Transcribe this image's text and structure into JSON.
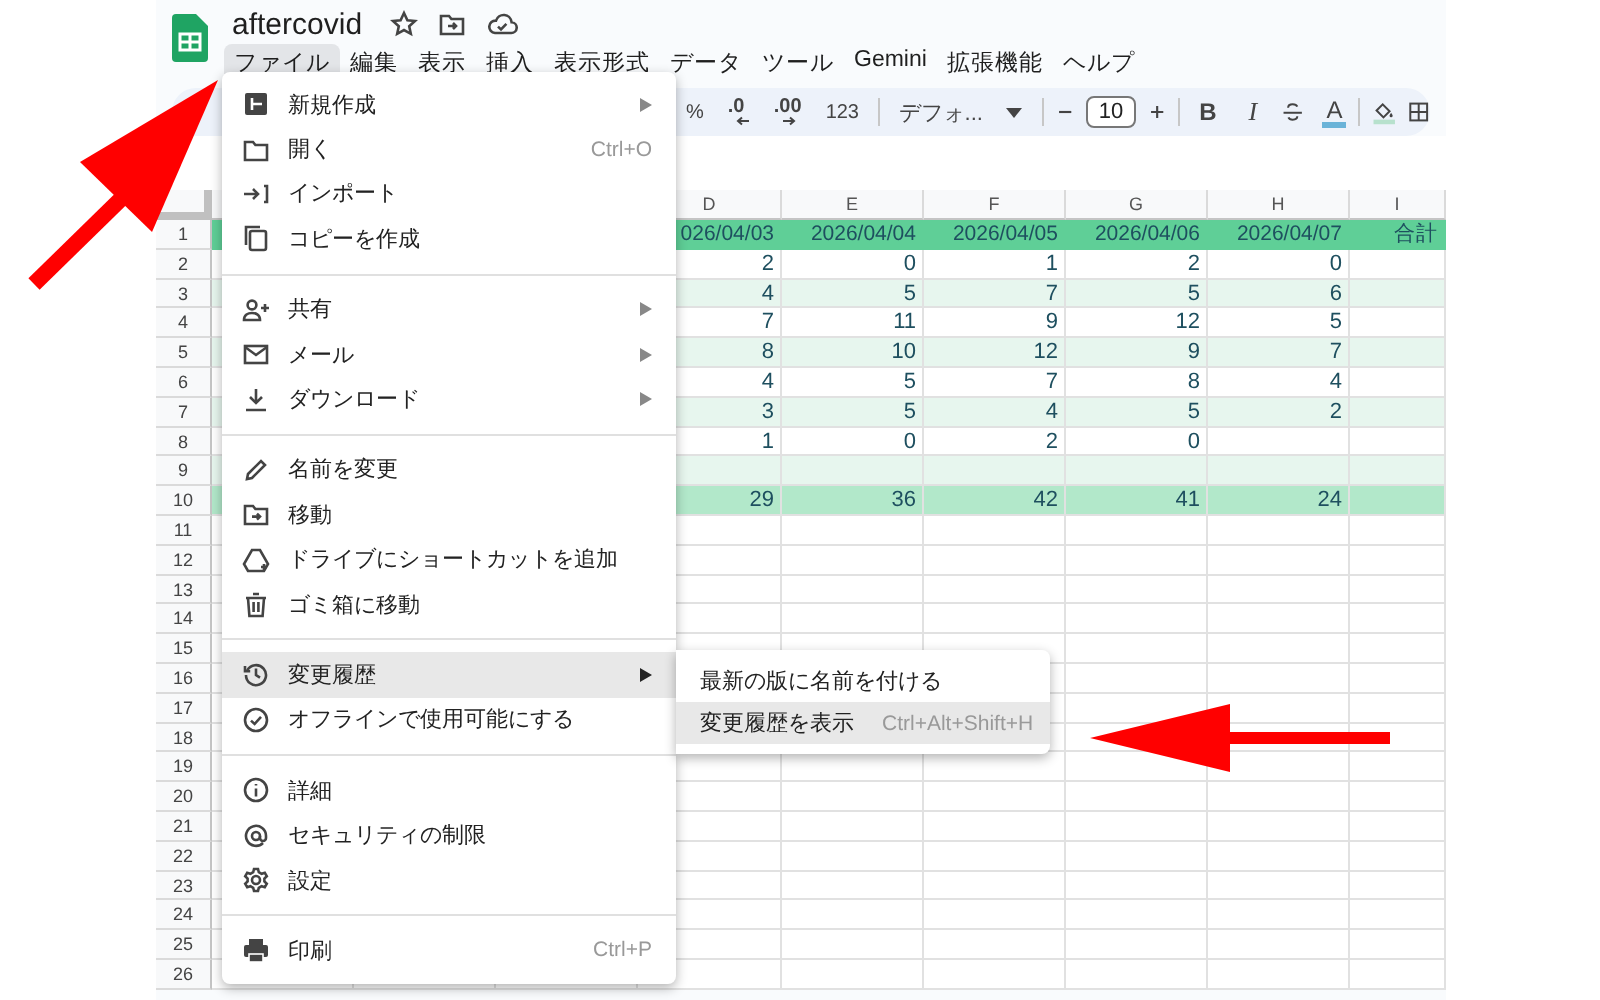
{
  "document": {
    "title": "aftercovid"
  },
  "menubar": [
    {
      "label": "ファイル",
      "selected": true
    },
    {
      "label": "編集",
      "selected": false
    },
    {
      "label": "表示",
      "selected": false
    },
    {
      "label": "挿入",
      "selected": false
    },
    {
      "label": "表示形式",
      "selected": false
    },
    {
      "label": "データ",
      "selected": false
    },
    {
      "label": "ツール",
      "selected": false
    },
    {
      "label": "Gemini",
      "selected": false
    },
    {
      "label": "拡張機能",
      "selected": false
    },
    {
      "label": "ヘルプ",
      "selected": false
    }
  ],
  "toolbar": [
    {
      "kind": "text",
      "label": "%"
    },
    {
      "kind": "decrease",
      "label": ".0"
    },
    {
      "kind": "increase",
      "label": ".00"
    },
    {
      "kind": "text",
      "label": "123"
    },
    {
      "kind": "sep"
    },
    {
      "kind": "font",
      "label": "デフォ..."
    },
    {
      "kind": "sep"
    },
    {
      "kind": "size",
      "label": "10"
    },
    {
      "kind": "sep"
    },
    {
      "kind": "bold",
      "label": "B"
    },
    {
      "kind": "italic",
      "label": "I"
    },
    {
      "kind": "strike"
    },
    {
      "kind": "color",
      "label": "A"
    },
    {
      "kind": "sep"
    },
    {
      "kind": "fill"
    },
    {
      "kind": "borders"
    }
  ],
  "sheet": {
    "columns": [
      "D",
      "E",
      "F",
      "G",
      "H",
      "I"
    ],
    "rows": [
      {
        "number": "1",
        "kind": "header",
        "cells": [
          "026/04/03",
          "2026/04/04",
          "2026/04/05",
          "2026/04/06",
          "2026/04/07",
          "合計"
        ]
      },
      {
        "number": "2",
        "kind": "plain",
        "cells": [
          "2",
          "0",
          "1",
          "2",
          "0"
        ]
      },
      {
        "number": "3",
        "kind": "band",
        "cells": [
          "4",
          "5",
          "7",
          "5",
          "6"
        ]
      },
      {
        "number": "4",
        "kind": "plain",
        "cells": [
          "7",
          "11",
          "9",
          "12",
          "5"
        ]
      },
      {
        "number": "5",
        "kind": "band",
        "cells": [
          "8",
          "10",
          "12",
          "9",
          "7"
        ]
      },
      {
        "number": "6",
        "kind": "plain",
        "cells": [
          "4",
          "5",
          "7",
          "8",
          "4"
        ]
      },
      {
        "number": "7",
        "kind": "band",
        "cells": [
          "3",
          "5",
          "4",
          "5",
          "2"
        ]
      },
      {
        "number": "8",
        "kind": "plain",
        "cells": [
          "1",
          "0",
          "2",
          "0"
        ]
      },
      {
        "number": "9",
        "kind": "band"
      },
      {
        "number": "10",
        "kind": "total",
        "cells": [
          "29",
          "36",
          "42",
          "41",
          "24"
        ]
      },
      {
        "number": "11",
        "kind": "plain"
      },
      {
        "number": "12",
        "kind": "plain"
      },
      {
        "number": "13",
        "kind": "plain"
      },
      {
        "number": "14",
        "kind": "plain"
      },
      {
        "number": "15",
        "kind": "plain"
      },
      {
        "number": "16",
        "kind": "plain"
      },
      {
        "number": "17",
        "kind": "plain"
      },
      {
        "number": "18",
        "kind": "plain"
      },
      {
        "number": "19",
        "kind": "plain"
      },
      {
        "number": "20",
        "kind": "plain"
      },
      {
        "number": "21",
        "kind": "plain"
      },
      {
        "number": "22",
        "kind": "plain"
      },
      {
        "number": "23",
        "kind": "plain"
      },
      {
        "number": "24",
        "kind": "plain"
      },
      {
        "number": "25",
        "kind": "plain"
      },
      {
        "number": "26",
        "kind": "plain"
      }
    ]
  },
  "file_menu": {
    "groups": [
      [
        {
          "kind": "new",
          "label": "新規作成",
          "submenu": true,
          "highlighted": false
        },
        {
          "kind": "open",
          "label": "開く",
          "shortcut": "Ctrl+O",
          "submenu": false,
          "highlighted": false
        },
        {
          "kind": "import",
          "label": "インポート",
          "submenu": false,
          "highlighted": false
        },
        {
          "kind": "copy",
          "label": "コピーを作成",
          "submenu": false,
          "highlighted": false
        }
      ],
      [
        {
          "kind": "share",
          "label": "共有",
          "submenu": true,
          "highlighted": false
        },
        {
          "kind": "email",
          "label": "メール",
          "submenu": true,
          "highlighted": false
        },
        {
          "kind": "download",
          "label": "ダウンロード",
          "submenu": true,
          "highlighted": false
        }
      ],
      [
        {
          "kind": "rename",
          "label": "名前を変更",
          "submenu": false,
          "highlighted": false
        },
        {
          "kind": "move",
          "label": "移動",
          "submenu": false,
          "highlighted": false
        },
        {
          "kind": "shortcut",
          "label": "ドライブにショートカットを追加",
          "submenu": false,
          "highlighted": false
        },
        {
          "kind": "trash",
          "label": "ゴミ箱に移動",
          "submenu": false,
          "highlighted": false
        }
      ],
      [
        {
          "kind": "history",
          "label": "変更履歴",
          "submenu": true,
          "highlighted": true
        },
        {
          "kind": "offline",
          "label": "オフラインで使用可能にする",
          "submenu": false,
          "highlighted": false
        }
      ],
      [
        {
          "kind": "details",
          "label": "詳細",
          "submenu": false,
          "highlighted": false
        },
        {
          "kind": "security",
          "label": "セキュリティの制限",
          "submenu": false,
          "highlighted": false
        },
        {
          "kind": "settings",
          "label": "設定",
          "submenu": false,
          "highlighted": false
        }
      ],
      [
        {
          "kind": "print",
          "label": "印刷",
          "shortcut": "Ctrl+P",
          "submenu": false,
          "highlighted": false
        }
      ]
    ]
  },
  "history_submenu": [
    {
      "label": "最新の版に名前を付ける",
      "highlighted": false
    },
    {
      "label": "変更履歴を表示",
      "shortcut": "Ctrl+Alt+Shift+H",
      "highlighted": true
    }
  ]
}
